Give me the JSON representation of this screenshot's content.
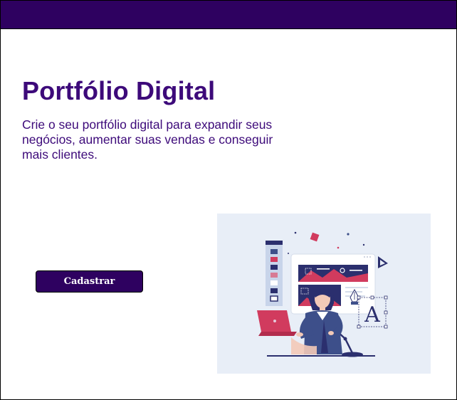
{
  "header": {
    "background": "#2e0160"
  },
  "hero": {
    "title": "Portfólio Digital",
    "subtitle": "Crie o seu portfólio digital para expandir seus negócios, aumentar suas vendas e conseguir mais clientes.",
    "cta_label": "Cadastrar",
    "accent_color": "#3d0a7a"
  },
  "illustration": {
    "icon": "designer-at-laptop-illustration",
    "letter": "A",
    "palette": [
      "#2b2f6e",
      "#d13b5e",
      "#e8eef7",
      "#ffffff",
      "#3d4f8a"
    ]
  }
}
